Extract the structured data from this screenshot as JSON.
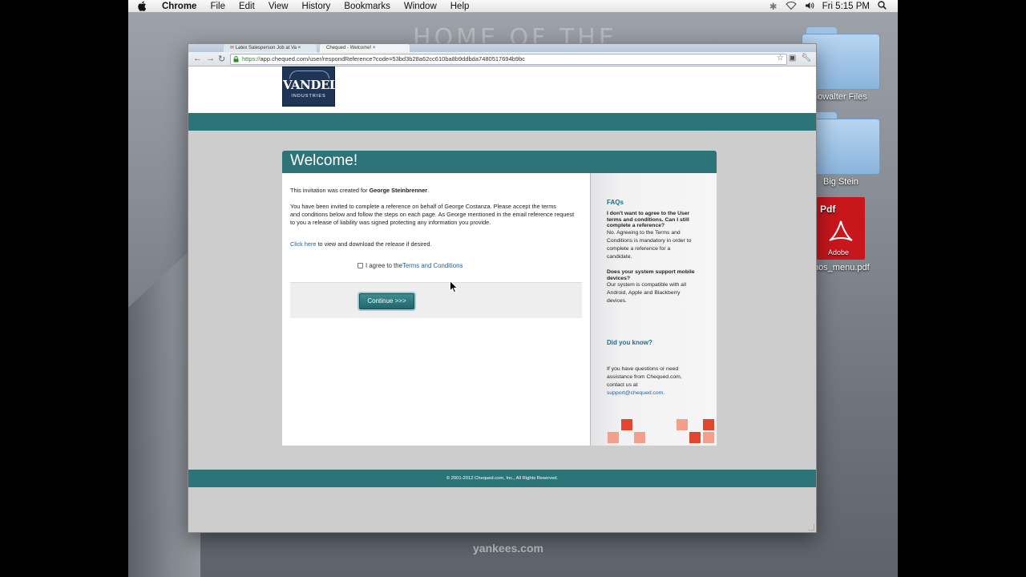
{
  "menubar": {
    "app": "Chrome",
    "menus": [
      "File",
      "Edit",
      "View",
      "History",
      "Bookmarks",
      "Window",
      "Help"
    ],
    "clock": "Fri 5:15 PM"
  },
  "wallpaper": {
    "title": "HOME OF THE",
    "bottom_text": "yankees.com"
  },
  "desktop": {
    "icons": [
      {
        "label": "k Showalter Files"
      },
      {
        "label": "Big Stein"
      },
      {
        "label": "sanos_menu.pdf",
        "badge": "Pdf",
        "brand": "Adobe"
      }
    ]
  },
  "browser": {
    "tabs": [
      "Latex Salesperson Job at Va",
      "Chequed - Welcome!"
    ],
    "url_scheme": "https://",
    "url_rest": "app.chequed.com/user/respondReference?code=53bd3b28a62cc610ba8b9ddbda7480517694b9bc"
  },
  "page": {
    "logo_main": "VANDELAY",
    "logo_sub": "INDUSTRIES",
    "card_title": "Welcome!",
    "intro_prefix": "This invitation was created for ",
    "intro_name": "George Steinbrenner",
    "intro_suffix": ".",
    "para_line1": "You have been invited to complete a reference on behalf of George Costanza. Please accept the terms",
    "para_line2": "and conditions below and follow the steps on each page. As George mentioned in the email reference request",
    "para_line3": "to you a release of liability was signed protecting any information you provide.",
    "click_link": "Click here",
    "click_suffix": " to view and download the release if desired.",
    "agree_prefix": "I agree to the ",
    "agree_link": "Terms and Conditions",
    "continue_label": "Continue >>>",
    "faq_heading": "FAQs",
    "faq1_q_l1": "I don't want to agree to the User",
    "faq1_q_l2": "terms and conditions. Can I still",
    "faq1_q_l3": "complete a reference?",
    "faq1_a_l1": "No. Agreeing to the Terms and",
    "faq1_a_l2": "Conditions is mandatory in order to",
    "faq1_a_l3": "complete a reference for a",
    "faq1_a_l4": "candidate.",
    "faq2_q_l1": "Does your system support mobile",
    "faq2_q_l2": "devices?",
    "faq2_a_l1": "Our system is compatible with all",
    "faq2_a_l2": "Android, Apple and Blackberry",
    "faq2_a_l3": "devices.",
    "dyk_heading": "Did you know?",
    "help_l1": "If you have questions or need",
    "help_l2": "assistance from Chequed.com,",
    "help_l3": "contact us at",
    "help_email": "support@chequed.com.",
    "footer": "© 2001-2012 Chequed.com, Inc., All Rights Reserved."
  },
  "colors": {
    "teal": "#2d7479",
    "link": "#1e5f9c",
    "logo_navy": "#1e3556",
    "accent_red": "#e0472e",
    "accent_pink": "#f0a08c"
  }
}
